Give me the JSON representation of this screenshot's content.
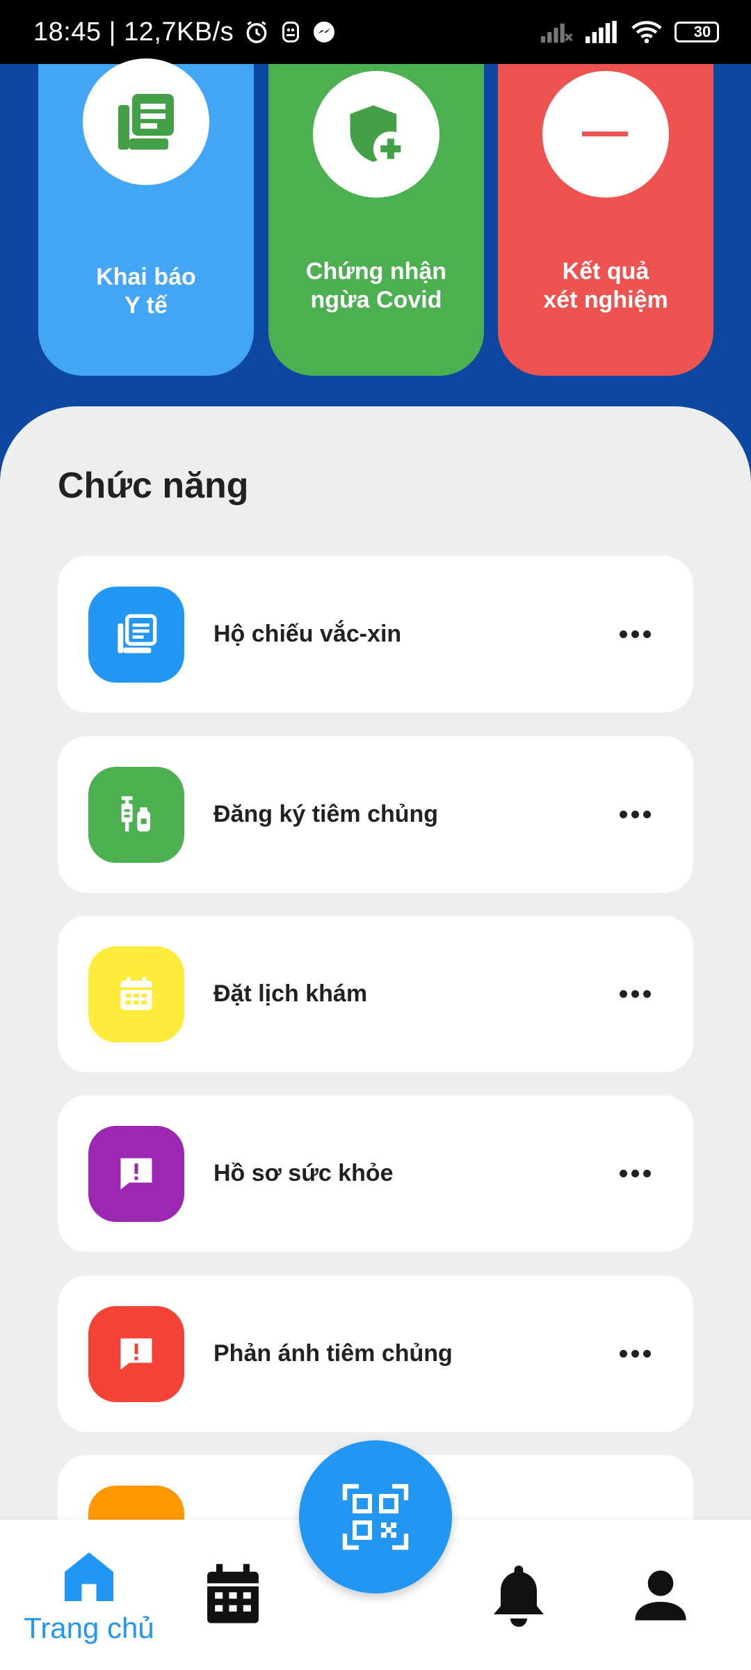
{
  "status_bar": {
    "time_speed": "18:45 | 12,7KB/s",
    "battery": "30",
    "icons": [
      "alarm-icon",
      "notification-icon",
      "messenger-icon",
      "no-signal-icon",
      "signal-icon",
      "wifi-icon",
      "battery-icon"
    ]
  },
  "quick_actions": [
    {
      "label": "Khai báo\nY tế",
      "icon": "document-icon",
      "color": "#42a5f5"
    },
    {
      "label": "Chứng nhận\nngừa Covid",
      "icon": "shield-plus-icon",
      "color": "#4caf50"
    },
    {
      "label": "Kết quả\nxét nghiệm",
      "icon": "minus-icon",
      "color": "#ef5350"
    }
  ],
  "section": {
    "title": "Chức năng"
  },
  "features": [
    {
      "label": "Hộ chiếu vắc-xin",
      "icon": "document-icon",
      "color": "#2196f3"
    },
    {
      "label": "Đăng ký tiêm chủng",
      "icon": "vaccine-icon",
      "color": "#4caf50"
    },
    {
      "label": "Đặt lịch khám",
      "icon": "calendar-icon",
      "color": "#ffeb3b"
    },
    {
      "label": "Hồ sơ sức khỏe",
      "icon": "alert-message-icon",
      "color": "#9c27b0"
    },
    {
      "label": "Phản ánh tiêm chủng",
      "icon": "alert-message-icon",
      "color": "#f44336"
    },
    {
      "label": "",
      "icon": "partially-hidden-icon",
      "color": "#ff9800"
    }
  ],
  "bottom_nav": {
    "home_label": "Trang chủ",
    "items": [
      "home-icon",
      "calendar-icon",
      "qr-scan-icon",
      "bell-icon",
      "profile-icon"
    ],
    "active_color": "#2196f3"
  }
}
